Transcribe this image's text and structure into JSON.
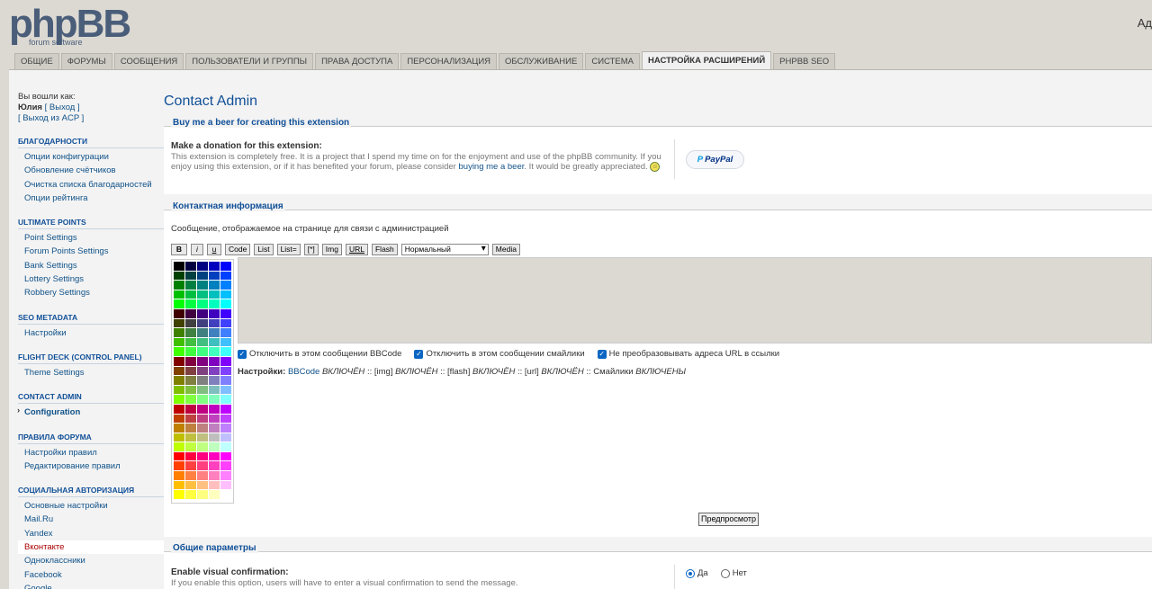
{
  "header": {
    "logo_main": "phpBB",
    "logo_sub": "forum software",
    "user_right": "Ад"
  },
  "tabs": [
    {
      "label": "ОБЩИЕ"
    },
    {
      "label": "ФОРУМЫ"
    },
    {
      "label": "СООБЩЕНИЯ"
    },
    {
      "label": "ПОЛЬЗОВАТЕЛИ И ГРУППЫ"
    },
    {
      "label": "ПРАВА ДОСТУПА"
    },
    {
      "label": "ПЕРСОНАЛИЗАЦИЯ"
    },
    {
      "label": "ОБСЛУЖИВАНИЕ"
    },
    {
      "label": "СИСТЕМА"
    },
    {
      "label": "НАСТРОЙКА РАСШИРЕНИЙ",
      "active": true
    },
    {
      "label": "PHPBB SEO"
    }
  ],
  "sidebar": {
    "logged_as": "Вы вошли как:",
    "username": "Юлия",
    "logout": "[ Выход ]",
    "logout_acp": "[ Выход из ACP ]",
    "sections": [
      {
        "title": "БЛАГОДАРНОСТИ",
        "items": [
          "Опции конфигурации",
          "Обновление счётчиков",
          "Очистка списка благодарностей",
          "Опции рейтинга"
        ]
      },
      {
        "title": "ULTIMATE POINTS",
        "items": [
          "Point Settings",
          "Forum Points Settings",
          "Bank Settings",
          "Lottery Settings",
          "Robbery Settings"
        ]
      },
      {
        "title": "SEO METADATA",
        "items": [
          "Настройки"
        ]
      },
      {
        "title": "FLIGHT DECK (CONTROL PANEL)",
        "items": [
          "Theme Settings"
        ]
      },
      {
        "title": "CONTACT ADMIN",
        "items": [
          "Configuration"
        ]
      },
      {
        "title": "ПРАВИЛА ФОРУМА",
        "items": [
          "Настройки правил",
          "Редактирование правил"
        ]
      },
      {
        "title": "СОЦИАЛЬНАЯ АВТОРИЗАЦИЯ",
        "items": [
          "Основные настройки",
          "Mail.Ru",
          "Yandex",
          "Вконтакте",
          "Одноклассники",
          "Facebook",
          "Google"
        ]
      }
    ]
  },
  "main": {
    "page_title": "Contact Admin",
    "donate": {
      "legend": "Buy me a beer for creating this extension",
      "title": "Make a donation for this extension:",
      "text_1": "This extension is completely free. It is a project that I spend my time on for the enjoyment and use of the phpBB community. If you enjoy using this extension, or if it has benefited your forum, please consider",
      "link": "buying me a beer",
      "text_2": ". It would be greatly appreciated.",
      "paypal_label": "PayPal"
    },
    "contact": {
      "legend": "Контактная информация",
      "description": "Сообщение, отображаемое на странице для связи с администрацией",
      "toolbar": {
        "bold": "B",
        "italic": "i",
        "underline": "u",
        "code": "Code",
        "list": "List",
        "list_ordered": "List=",
        "list_item": "[*]",
        "img": "Img",
        "url": "URL",
        "flash": "Flash",
        "size_select": "Нормальный",
        "media": "Media"
      },
      "message_value": "",
      "disable_bbcode": "Отключить в этом сообщении BBCode",
      "disable_smilies": "Отключить в этом сообщении смайлики",
      "disable_urls": "Не преобразовывать адреса URL в ссылки",
      "settings_label": "Настройки:",
      "settings_bbcode": "BBCode",
      "settings_bbcode_state": "ВКЛЮЧЁН",
      "settings_img": ":: [img]",
      "settings_img_state": "ВКЛЮЧЁН",
      "settings_flash": ":: [flash]",
      "settings_flash_state": "ВКЛЮЧЁН",
      "settings_url": ":: [url]",
      "settings_url_state": "ВКЛЮЧЁН",
      "settings_smilies": ":: Смайлики",
      "settings_smilies_state": "ВКЛЮЧЕНЫ",
      "preview_button": "Предпросмотр"
    },
    "general": {
      "legend": "Общие параметры",
      "vc_title": "Enable visual confirmation:",
      "vc_text": "If you enable this option, users will have to enter a visual confirmation to send the message.",
      "yes": "Да",
      "no": "Нет"
    }
  },
  "colors": {
    "link": "#105289",
    "heading": "#115098",
    "checkbox": "#0a66c2"
  }
}
